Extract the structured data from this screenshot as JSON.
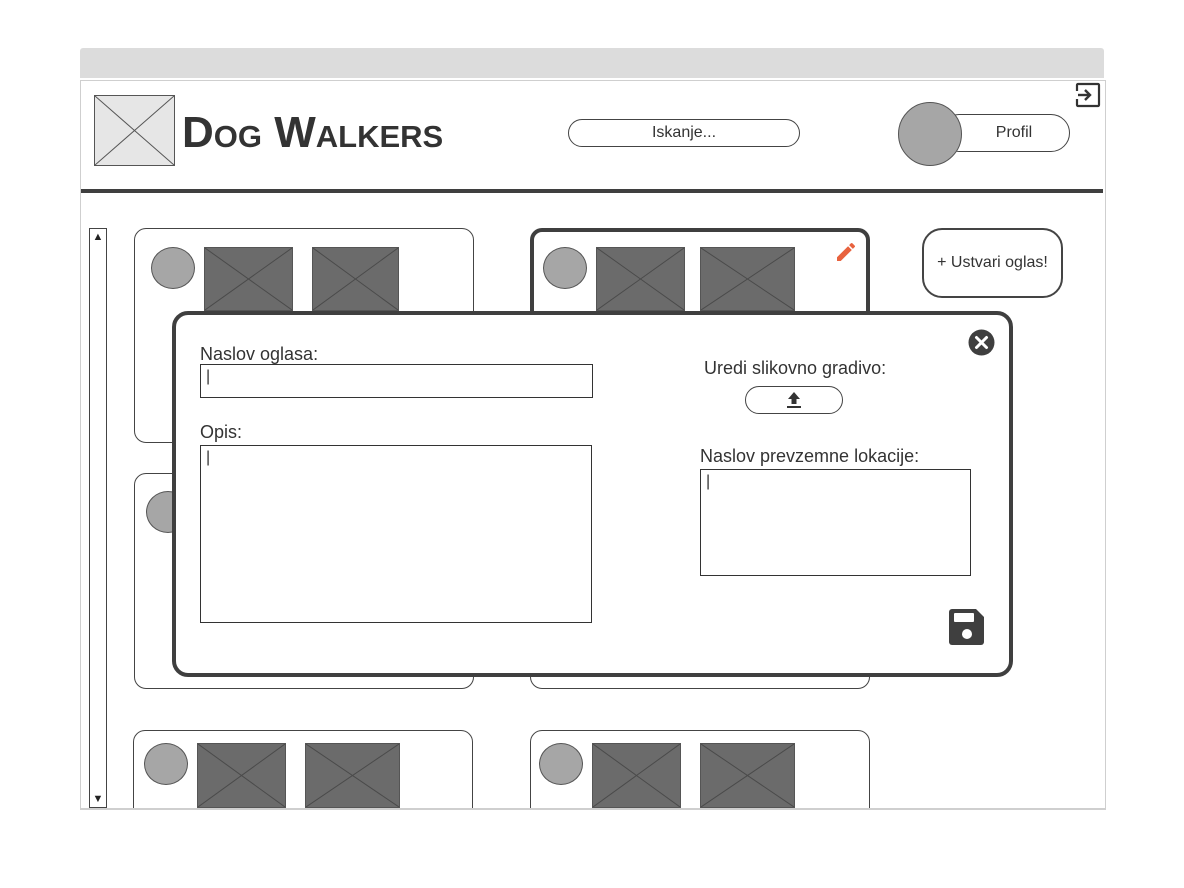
{
  "header": {
    "app_title": "Dog Walkers",
    "search_placeholder": "Iskanje...",
    "profile_label": "Profil"
  },
  "actions": {
    "create_ad_label": "+ Ustvari oglas!"
  },
  "modal": {
    "title_label": "Naslov oglasa:",
    "title_value": "|",
    "description_label": "Opis:",
    "description_value": "|",
    "media_label": "Uredi slikovno gradivo:",
    "pickup_label": "Naslov prevzemne lokacije:",
    "pickup_value": "|"
  },
  "icons": {
    "logout": "logout-icon",
    "edit": "pencil-icon",
    "close": "close-icon",
    "upload": "upload-icon",
    "save": "save-icon",
    "scroll_up": "▲",
    "scroll_down": "▼"
  },
  "colors": {
    "accent": "#e8623e",
    "dark": "#3f3f3f",
    "placeholder_fill": "#6b6b6b",
    "avatar_fill": "#a6a6a6"
  }
}
